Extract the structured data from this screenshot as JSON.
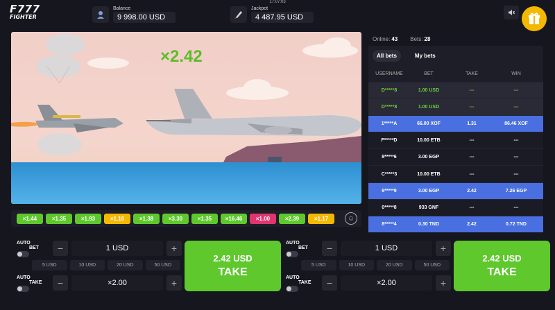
{
  "header": {
    "clock": "17:07:03",
    "logo_line1": "F777",
    "logo_line2": "FIGHTER",
    "balance_label": "Balance",
    "balance_value": "9 998.00 USD",
    "jackpot_label": "Jackpot",
    "jackpot_value": "4 487.95 USD"
  },
  "game": {
    "multiplier": "×2.42"
  },
  "sidebar": {
    "online_label": "Online:",
    "online_value": "43",
    "bets_label": "Bets:",
    "bets_value": "28",
    "tabs": [
      "All bets",
      "My bets"
    ],
    "columns": [
      "USERNAME",
      "BET",
      "TAKE",
      "WIN"
    ],
    "rows": [
      {
        "user": "D*****8",
        "bet": "1.00 USD",
        "take": "---",
        "win": "---",
        "style": "green"
      },
      {
        "user": "D*****8",
        "bet": "1.00 USD",
        "take": "---",
        "win": "---",
        "style": "green"
      },
      {
        "user": "1*****A",
        "bet": "66.00 XOF",
        "take": "1.31",
        "win": "86.46 XOF",
        "style": "win"
      },
      {
        "user": "F*****D",
        "bet": "10.00 ETB",
        "take": "---",
        "win": "---",
        "style": "normal"
      },
      {
        "user": "8*****6",
        "bet": "3.00 EGP",
        "take": "---",
        "win": "---",
        "style": "normal"
      },
      {
        "user": "C*****3",
        "bet": "10.00 ETB",
        "take": "---",
        "win": "---",
        "style": "normal"
      },
      {
        "user": "6*****9",
        "bet": "3.00 EGP",
        "take": "2.42",
        "win": "7.26 EGP",
        "style": "win"
      },
      {
        "user": "0*****8",
        "bet": "933 GNF",
        "take": "---",
        "win": "---",
        "style": "normal"
      },
      {
        "user": "8*****4",
        "bet": "0.30 TND",
        "take": "2.42",
        "win": "0.72 TND",
        "style": "win"
      }
    ]
  },
  "history": [
    {
      "value": "×1.44",
      "color": "#5ec82d"
    },
    {
      "value": "×1.35",
      "color": "#5ec82d"
    },
    {
      "value": "×1.93",
      "color": "#5ec82d"
    },
    {
      "value": "×1.16",
      "color": "#f5b800"
    },
    {
      "value": "×1.38",
      "color": "#5ec82d"
    },
    {
      "value": "×3.30",
      "color": "#5ec82d"
    },
    {
      "value": "×1.35",
      "color": "#5ec82d"
    },
    {
      "value": "×16.46",
      "color": "#5ec82d"
    },
    {
      "value": "×1.00",
      "color": "#e0356f"
    },
    {
      "value": "×2.39",
      "color": "#5ec82d"
    },
    {
      "value": "×1.17",
      "color": "#f5b800"
    }
  ],
  "bet_panels": [
    {
      "auto_label": "AUTO",
      "bet_label": "BET",
      "take_label": "TAKE",
      "bet_value": "1 USD",
      "take_value": "×2.00",
      "quick": [
        "5 USD",
        "10 USD",
        "20 USD",
        "50 USD"
      ],
      "button_amount": "2.42 USD",
      "button_label": "TAKE"
    },
    {
      "auto_label": "AUTO",
      "bet_label": "BET",
      "take_label": "TAKE",
      "bet_value": "1 USD",
      "take_value": "×2.00",
      "quick": [
        "5 USD",
        "10 USD",
        "20 USD",
        "50 USD"
      ],
      "button_amount": "2.42 USD",
      "button_label": "TAKE"
    }
  ],
  "colors": {
    "accent_green": "#5ec82d",
    "win_row": "#4a6fe0",
    "background": "#16161f"
  }
}
